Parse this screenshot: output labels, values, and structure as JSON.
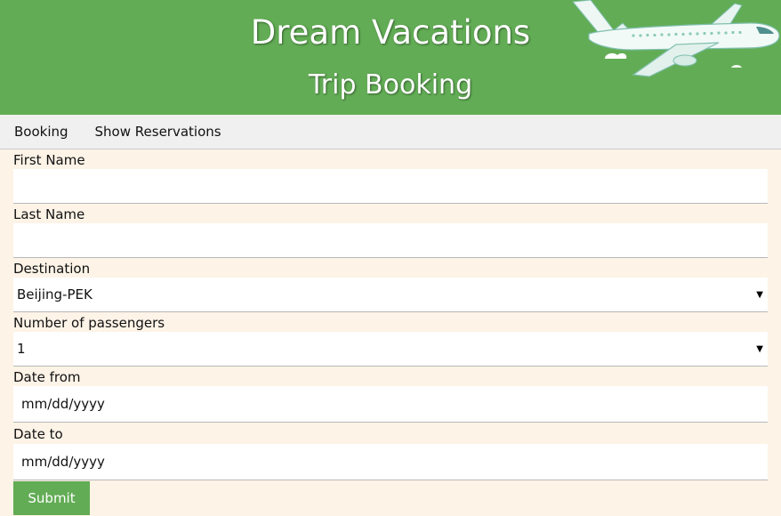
{
  "header": {
    "site_title": "Dream Vacations",
    "subtitle": "Trip Booking",
    "background_color": "#62ac55",
    "decoration_icon": "airplane-icon"
  },
  "nav": {
    "items": [
      {
        "label": "Booking"
      },
      {
        "label": "Show Reservations"
      }
    ]
  },
  "form": {
    "first_name": {
      "label": "First Name",
      "value": ""
    },
    "last_name": {
      "label": "Last Name",
      "value": ""
    },
    "destination": {
      "label": "Destination",
      "selected": "Beijing-PEK"
    },
    "passengers": {
      "label": "Number of passengers",
      "selected": "1"
    },
    "date_from": {
      "label": "Date from",
      "placeholder": "mm/dd/yyyy"
    },
    "date_to": {
      "label": "Date to",
      "placeholder": "mm/dd/yyyy"
    },
    "submit_label": "Submit",
    "dropdown_arrow": "▼"
  },
  "colors": {
    "accent": "#62ac55",
    "page_background": "#fdf3e7",
    "nav_background": "#f0f0f0"
  }
}
